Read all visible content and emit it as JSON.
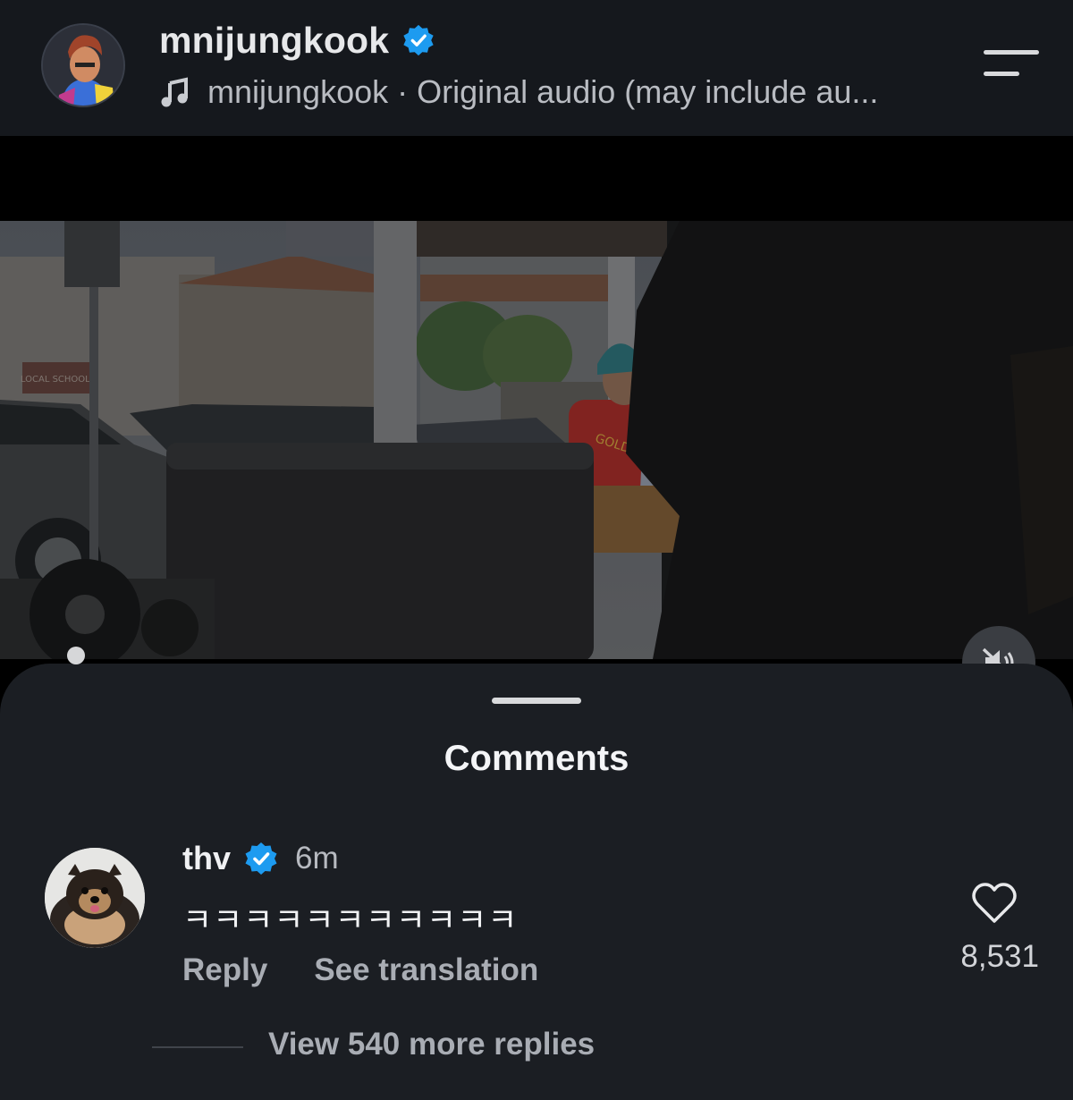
{
  "header": {
    "username": "mnijungkook",
    "audio_text": "mnijungkook · Original audio (may include au...",
    "verified_icon": "verified-badge-icon",
    "music_icon": "music-note-icon",
    "menu_icon": "menu-icon",
    "accent_color": "#1d9bf0"
  },
  "video": {
    "storefront_sign": "LOCAL SCHOOLS",
    "shirt_text": "GOLD'S",
    "mute_icon": "speaker-muted-icon"
  },
  "comments": {
    "title": "Comments",
    "items": [
      {
        "username": "thv",
        "time": "6m",
        "text": "ㅋㅋㅋㅋㅋㅋㅋㅋㅋㅋㅋ",
        "reply_label": "Reply",
        "translation_label": "See translation",
        "like_count": "8,531",
        "view_replies_label": "View 540 more replies"
      }
    ]
  }
}
